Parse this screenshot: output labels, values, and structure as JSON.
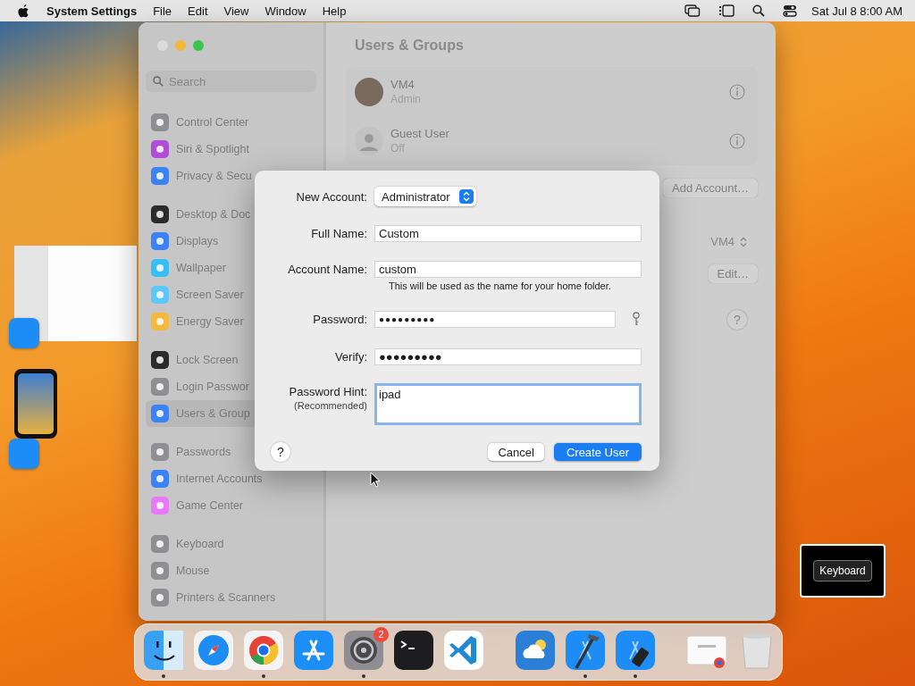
{
  "menu_bar": {
    "app_name": "System Settings",
    "menus": [
      "File",
      "Edit",
      "View",
      "Window",
      "Help"
    ],
    "clock": "Sat Jul 8  8:00 AM"
  },
  "window": {
    "title": "Users & Groups",
    "search": {
      "placeholder": "Search"
    },
    "sidebar": {
      "groups": [
        [
          {
            "label": "Control Center",
            "kind": "control",
            "selected": false
          },
          {
            "label": "Siri & Spotlight",
            "kind": "siri",
            "selected": false
          },
          {
            "label": "Privacy & Secu",
            "kind": "privacy",
            "selected": false
          }
        ],
        [
          {
            "label": "Desktop & Doc",
            "kind": "desktop",
            "selected": false
          },
          {
            "label": "Displays",
            "kind": "displays",
            "selected": false
          },
          {
            "label": "Wallpaper",
            "kind": "wallpaper",
            "selected": false
          },
          {
            "label": "Screen Saver",
            "kind": "screensaver",
            "selected": false
          },
          {
            "label": "Energy Saver",
            "kind": "energy",
            "selected": false
          }
        ],
        [
          {
            "label": "Lock Screen",
            "kind": "lock",
            "selected": false
          },
          {
            "label": "Login Passwor",
            "kind": "login",
            "selected": false
          },
          {
            "label": "Users & Group",
            "kind": "users",
            "selected": true
          }
        ],
        [
          {
            "label": "Passwords",
            "kind": "passwords",
            "selected": false
          },
          {
            "label": "Internet Accounts",
            "kind": "internet",
            "selected": false
          },
          {
            "label": "Game Center",
            "kind": "gamecenter",
            "selected": false
          }
        ],
        [
          {
            "label": "Keyboard",
            "kind": "keyboard",
            "selected": false
          },
          {
            "label": "Mouse",
            "kind": "mouse",
            "selected": false
          },
          {
            "label": "Printers & Scanners",
            "kind": "printers",
            "selected": false
          }
        ]
      ]
    },
    "users": [
      {
        "name": "VM4",
        "role": "Admin",
        "kind": "photo"
      },
      {
        "name": "Guest User",
        "role": "Off",
        "kind": "silhouette"
      }
    ],
    "add_account_button": "Add Account…",
    "login_popup": "VM4",
    "edit_button": "Edit…",
    "help_button": "?"
  },
  "dialog": {
    "new_account": {
      "label": "New Account:",
      "value": "Administrator"
    },
    "fields": [
      {
        "label": "Full Name:",
        "value": "Custom",
        "kind": "text"
      },
      {
        "label": "Account Name:",
        "value": "custom",
        "kind": "text",
        "note": "This will be used as the name for your home folder."
      },
      {
        "label": "Password:",
        "value": "●●●●●●●●●",
        "kind": "password"
      },
      {
        "label": "Verify:",
        "value": "●●●●●●●●●",
        "kind": "text"
      },
      {
        "label": "Password Hint:",
        "sublabel": "(Recommended)",
        "value": "ipad",
        "kind": "multiline"
      }
    ],
    "help_button": "?",
    "buttons": [
      {
        "label": "Cancel",
        "kind": "normal"
      },
      {
        "label": "Create User",
        "kind": "default"
      }
    ]
  },
  "dock": {
    "apps": [
      {
        "kind": "finder",
        "running": true
      },
      {
        "kind": "safari",
        "running": false
      },
      {
        "kind": "chrome",
        "running": true
      },
      {
        "kind": "appstore",
        "running": false
      },
      {
        "kind": "settings",
        "running": true,
        "badge": "2"
      },
      {
        "kind": "terminal",
        "running": false
      },
      {
        "kind": "vscode",
        "running": false
      },
      {
        "kind": "separator"
      },
      {
        "kind": "weather",
        "running": false
      },
      {
        "kind": "xcode",
        "running": true
      },
      {
        "kind": "simulator",
        "running": true
      },
      {
        "kind": "separator"
      },
      {
        "kind": "browser-window",
        "running": false
      },
      {
        "kind": "trash",
        "running": false
      }
    ]
  },
  "key_overlay": {
    "label": "Keyboard"
  }
}
